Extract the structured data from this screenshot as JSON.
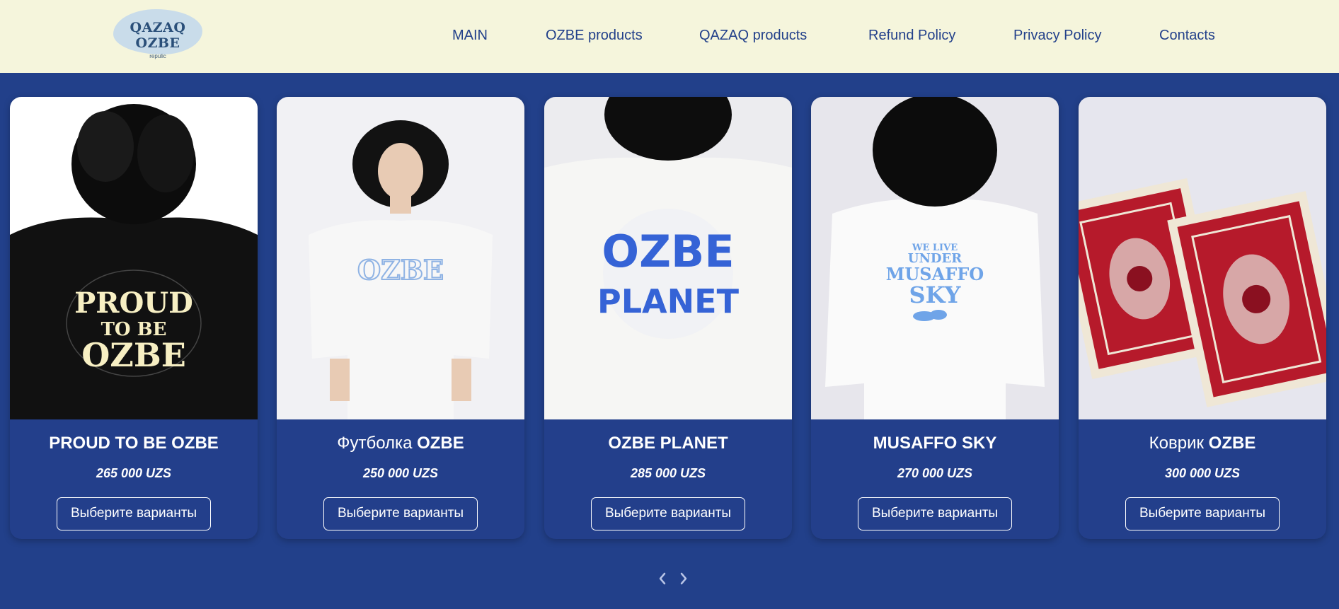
{
  "header": {
    "logo": {
      "title": "QAZAQ OZBE",
      "subtitle": "repulic"
    },
    "nav": [
      {
        "label": "MAIN"
      },
      {
        "label": "OZBE products"
      },
      {
        "label": "QAZAQ products"
      },
      {
        "label": "Refund Policy"
      },
      {
        "label": "Privacy Policy"
      },
      {
        "label": "Contacts"
      }
    ]
  },
  "products": [
    {
      "title_plain": "",
      "title_bold": "PROUD TO BE OZBE",
      "price": "265 000 UZS",
      "button_label": "Выберите варианты",
      "image": {
        "tshirt_color": "#111111",
        "print_lines": [
          "PROUD",
          "TO BE",
          "OZBE"
        ],
        "print_color": "#f7efc3",
        "view": "back"
      }
    },
    {
      "title_plain": "Футболка ",
      "title_bold": "OZBE",
      "price": "250 000 UZS",
      "button_label": "Выберите варианты",
      "image": {
        "tshirt_color": "#f7f7f7",
        "print_lines": [
          "OZBE"
        ],
        "print_color": "#8fb3e4",
        "view": "front"
      }
    },
    {
      "title_plain": "",
      "title_bold": "OZBE PLANET",
      "price": "285 000 UZS",
      "button_label": "Выберите варианты",
      "image": {
        "tshirt_color": "#f6f6f4",
        "print_lines": [
          "OZBE",
          "PLANET"
        ],
        "print_color": "#3563d6",
        "view": "back"
      }
    },
    {
      "title_plain": "",
      "title_bold": "MUSAFFO SKY",
      "price": "270 000 UZS",
      "button_label": "Выберите варианты",
      "image": {
        "tshirt_color": "#fafafa",
        "print_lines": [
          "WE LIVE",
          "UNDER",
          "MUSAFFO",
          "SKY"
        ],
        "print_color": "#6fa4e8",
        "view": "back"
      }
    },
    {
      "title_plain": "Коврик ",
      "title_bold": "OZBE",
      "price": "300 000 UZS",
      "button_label": "Выберите варианты",
      "image": {
        "carpet_color": "#b61a2b",
        "border_color": "#efe7d6"
      }
    }
  ],
  "carousel": {
    "prev_icon": "chevron-left-icon",
    "next_icon": "chevron-right-icon"
  },
  "colors": {
    "background": "#22408a",
    "header_bg": "#f5f5dc",
    "text_on_dark": "#ffffff",
    "nav_text": "#22408a"
  }
}
